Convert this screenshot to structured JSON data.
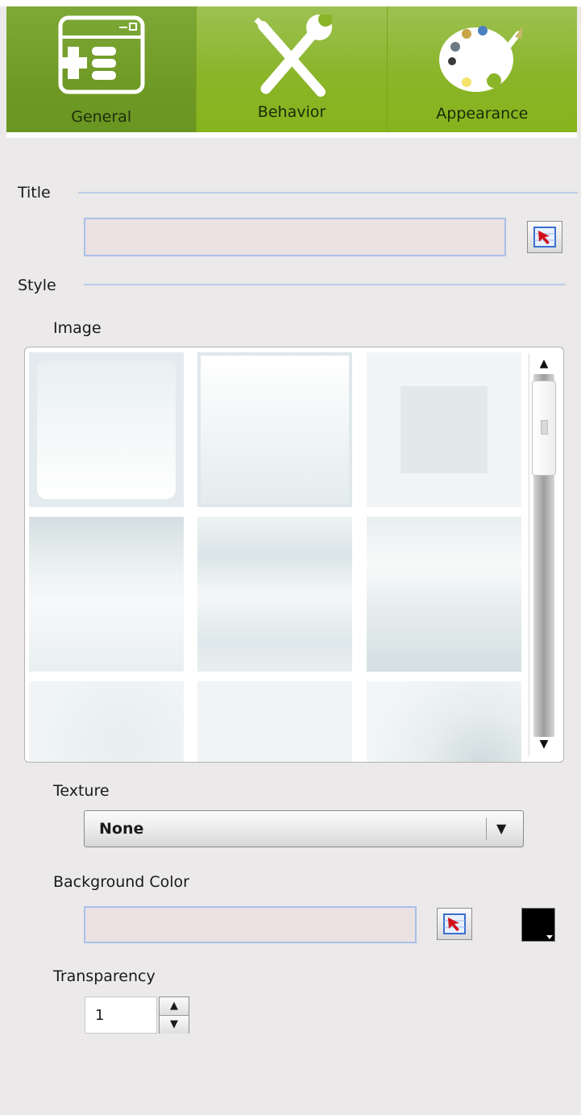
{
  "tabs": [
    {
      "label": "General",
      "icon": "window-form-icon",
      "active": true
    },
    {
      "label": "Behavior",
      "icon": "wrench-screwdriver-icon",
      "active": false
    },
    {
      "label": "Appearance",
      "icon": "palette-icon",
      "active": false
    }
  ],
  "sections": {
    "title": {
      "label": "Title",
      "value": "",
      "picker_icon": "cursor-select-icon"
    },
    "style": {
      "label": "Style"
    }
  },
  "image": {
    "label": "Image",
    "thumbnails": [
      "style-thumb-1",
      "style-thumb-2",
      "style-thumb-3",
      "style-thumb-4",
      "style-thumb-5",
      "style-thumb-6",
      "style-thumb-7",
      "style-thumb-8",
      "style-thumb-9"
    ],
    "scroll_position": 0.05
  },
  "texture": {
    "label": "Texture",
    "selected": "None"
  },
  "background_color": {
    "label": "Background Color",
    "value": "",
    "swatch_color": "#000000"
  },
  "transparency": {
    "label": "Transparency",
    "value": "1"
  },
  "colors": {
    "tab_green": "#8ab529",
    "tab_active": "#6f9a26",
    "field_border": "#a9bfe8",
    "section_line": "#b9cde6"
  }
}
